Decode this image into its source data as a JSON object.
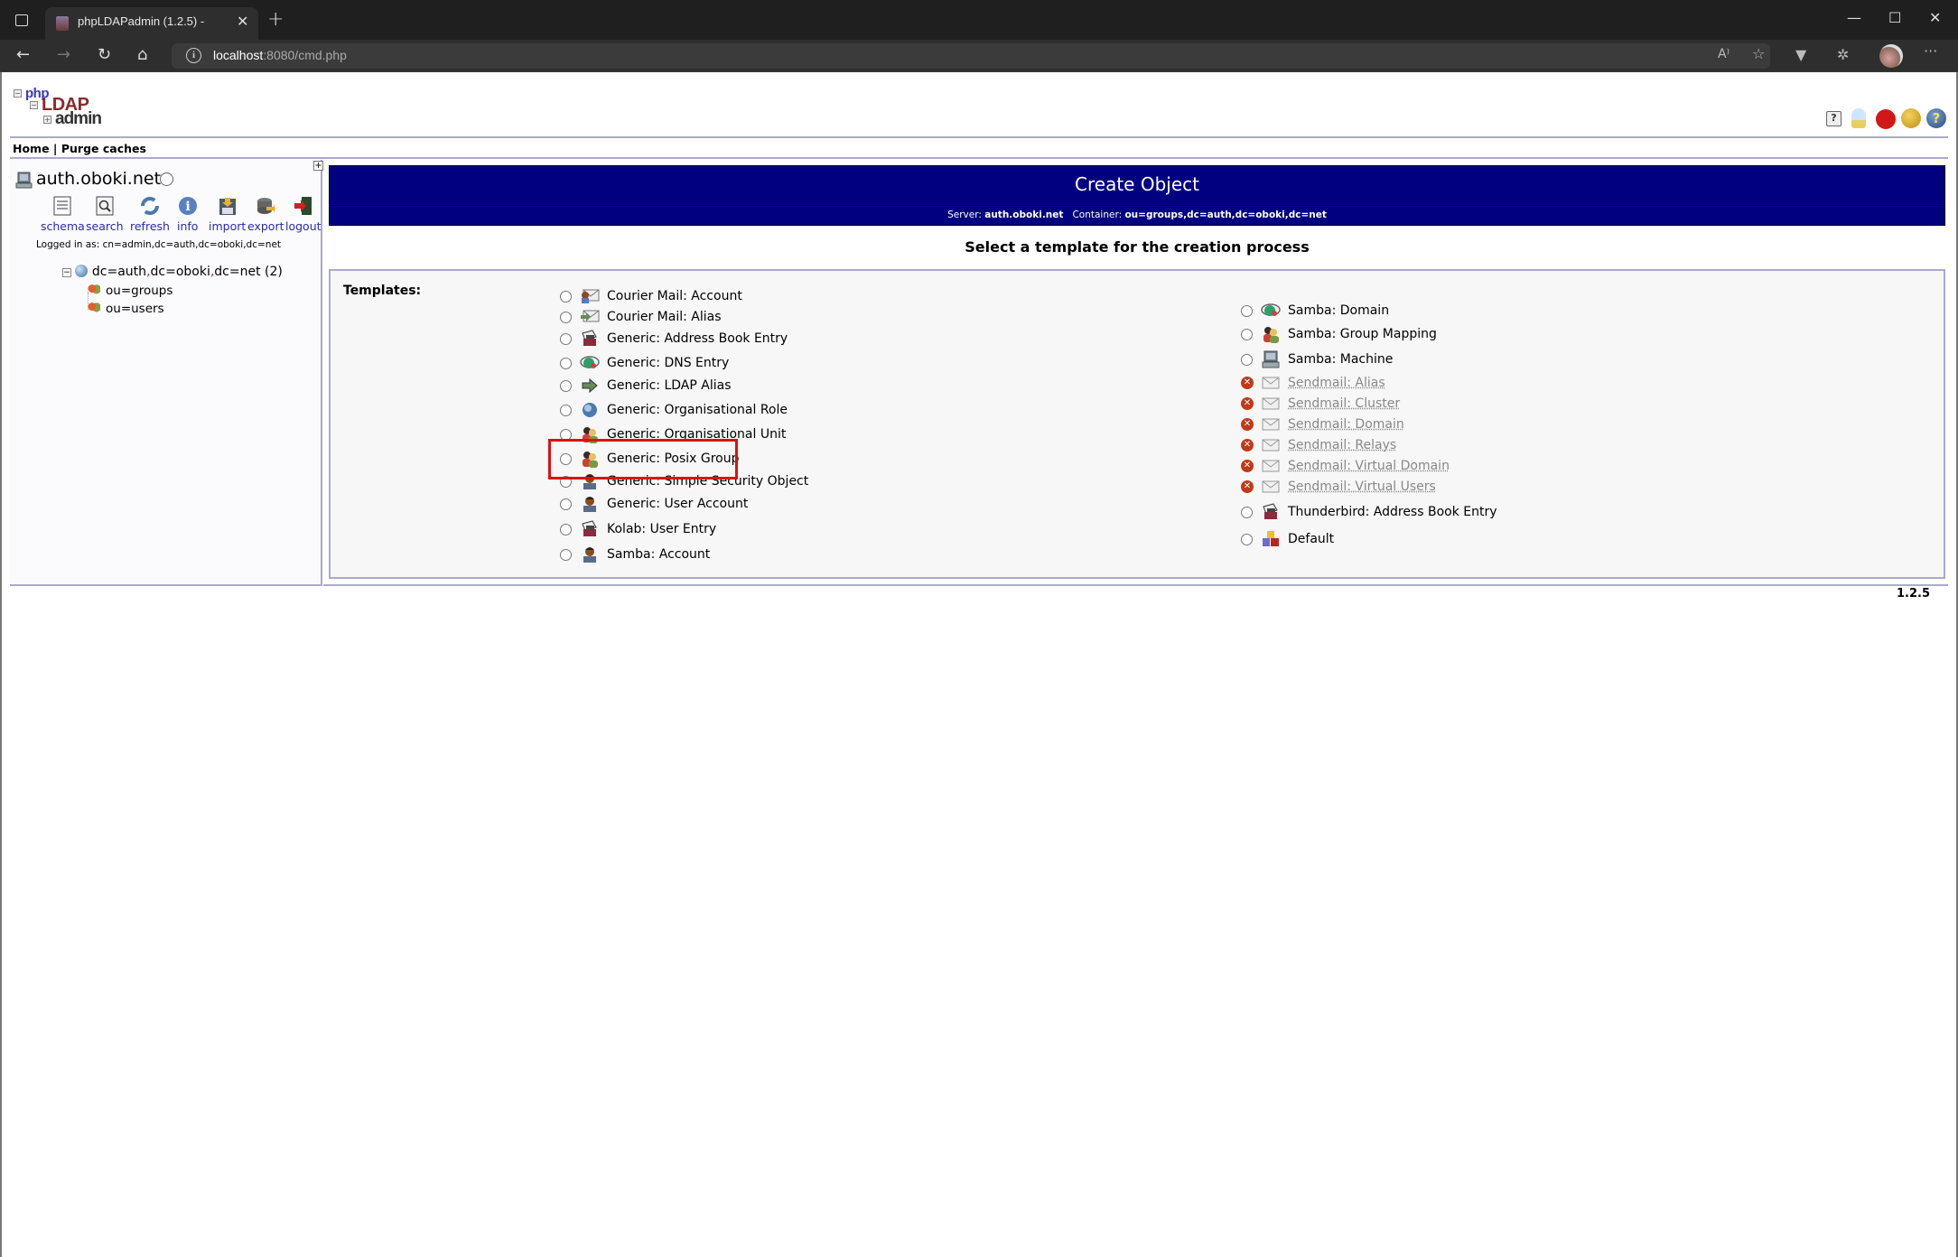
{
  "browser": {
    "tab_title": "phpLDAPadmin (1.2.5) -",
    "url_host": "localhost",
    "url_rest": ":8080/cmd.php"
  },
  "logo": {
    "php": "php",
    "ldap": "LDAP",
    "admin": "admin"
  },
  "topnav": {
    "home": "Home",
    "separator": "|",
    "purge": "Purge caches"
  },
  "header_icons": [
    "comment-icon",
    "lightbulb-icon",
    "bug-icon",
    "smiley-icon",
    "help-icon"
  ],
  "left": {
    "server_name": "auth.oboki.net",
    "tools": [
      {
        "label": "schema",
        "icon": "schema-icon"
      },
      {
        "label": "search",
        "icon": "search-icon"
      },
      {
        "label": "refresh",
        "icon": "refresh-icon"
      },
      {
        "label": "info",
        "icon": "info-icon"
      },
      {
        "label": "import",
        "icon": "import-icon"
      },
      {
        "label": "export",
        "icon": "export-icon"
      },
      {
        "label": "logout",
        "icon": "logout-icon"
      }
    ],
    "logged_in": "Logged in as: cn=admin,dc=auth,dc=oboki,dc=net",
    "tree": {
      "root_parts": [
        "dc=auth",
        "dc=oboki",
        "dc=net"
      ],
      "root_comma": ",",
      "root_count": "(2)",
      "children": [
        "ou=groups",
        "ou=users"
      ]
    }
  },
  "main": {
    "title": "Create Object",
    "server_label": "Server:",
    "server_value": "auth.oboki.net",
    "container_label": "Container:",
    "container_value": "ou=groups,dc=auth,dc=oboki,dc=net",
    "select_title": "Select a template for the creation process",
    "templates_label": "Templates:",
    "left_templates": [
      {
        "label": "Courier Mail: Account",
        "icon": "mail-account-icon",
        "enabled": true
      },
      {
        "label": "Courier Mail: Alias",
        "icon": "mail-alias-icon",
        "enabled": true
      },
      {
        "label": "Generic: Address Book Entry",
        "icon": "address-book-icon",
        "enabled": true
      },
      {
        "label": "Generic: DNS Entry",
        "icon": "dns-icon",
        "enabled": true
      },
      {
        "label": "Generic: LDAP Alias",
        "icon": "arrow-icon",
        "enabled": true
      },
      {
        "label": "Generic: Organisational Role",
        "icon": "globe-icon",
        "enabled": true
      },
      {
        "label": "Generic: Organisational Unit",
        "icon": "group-icon",
        "enabled": true
      },
      {
        "label": "Generic: Posix Group",
        "icon": "group-icon",
        "enabled": true
      },
      {
        "label": "Generic: Simple Security Object",
        "icon": "user-icon",
        "enabled": true
      },
      {
        "label": "Generic: User Account",
        "icon": "user-icon",
        "enabled": true
      },
      {
        "label": "Kolab: User Entry",
        "icon": "address-book-icon",
        "enabled": true
      },
      {
        "label": "Samba: Account",
        "icon": "user-icon",
        "enabled": true
      }
    ],
    "right_templates": [
      {
        "label": "Samba: Domain",
        "icon": "dns-icon",
        "enabled": true
      },
      {
        "label": "Samba: Group Mapping",
        "icon": "group-icon",
        "enabled": true
      },
      {
        "label": "Samba: Machine",
        "icon": "computer-icon",
        "enabled": true
      },
      {
        "label": "Sendmail: Alias",
        "icon": "mail-icon",
        "enabled": false
      },
      {
        "label": "Sendmail: Cluster",
        "icon": "mail-icon",
        "enabled": false
      },
      {
        "label": "Sendmail: Domain",
        "icon": "mail-icon",
        "enabled": false
      },
      {
        "label": "Sendmail: Relays",
        "icon": "mail-icon",
        "enabled": false
      },
      {
        "label": "Sendmail: Virtual Domain",
        "icon": "mail-icon",
        "enabled": false
      },
      {
        "label": "Sendmail: Virtual Users",
        "icon": "mail-icon",
        "enabled": false
      },
      {
        "label": "Thunderbird: Address Book Entry",
        "icon": "address-book-icon",
        "enabled": true
      },
      {
        "label": "Default",
        "icon": "cubes-icon",
        "enabled": true
      }
    ]
  },
  "footer": {
    "version": "1.2.5"
  }
}
